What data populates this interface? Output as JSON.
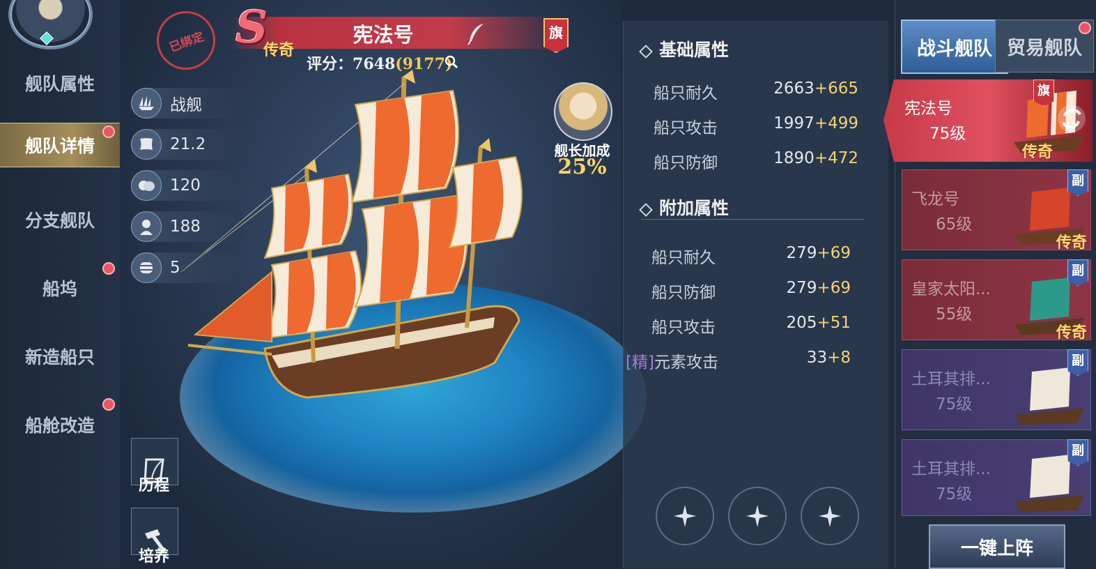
{
  "nav": {
    "items": [
      {
        "label": "舰队属性",
        "active": false,
        "dot": false
      },
      {
        "label": "舰队详情",
        "active": true,
        "dot": true
      },
      {
        "label": "分支舰队",
        "active": false,
        "dot": false
      },
      {
        "label": "船坞",
        "active": false,
        "dot": true
      },
      {
        "label": "新造船只",
        "active": false,
        "dot": false
      },
      {
        "label": "船舱改造",
        "active": false,
        "dot": true
      }
    ]
  },
  "ship": {
    "bound_label": "已绑定",
    "grade": "S",
    "grade_tag": "传奇",
    "name": "宪法号",
    "flag": "旗",
    "score_label": "评分：",
    "score": "7648",
    "score_max": "(9177)"
  },
  "stats": [
    {
      "icon": "ship-type-icon",
      "value": "战舰"
    },
    {
      "icon": "sail-speed-icon",
      "value": "21.2"
    },
    {
      "icon": "supply-icon",
      "value": "120"
    },
    {
      "icon": "sailor-icon",
      "value": "188"
    },
    {
      "icon": "cargo-barrel-icon",
      "value": "5"
    }
  ],
  "captain": {
    "label": "舰长加成",
    "bonus": "25%"
  },
  "side_buttons": {
    "history": "历程",
    "train": "培养"
  },
  "base_attrs": {
    "title": "基础属性",
    "rows": [
      {
        "name": "船只耐久",
        "value": "2663",
        "bonus": "+665"
      },
      {
        "name": "船只攻击",
        "value": "1997",
        "bonus": "+499"
      },
      {
        "name": "船只防御",
        "value": "1890",
        "bonus": "+472"
      }
    ]
  },
  "extra_attrs": {
    "title": "附加属性",
    "rows": [
      {
        "prefix": "",
        "name": "船只耐久",
        "value": "279",
        "bonus": "+69"
      },
      {
        "prefix": "",
        "name": "船只防御",
        "value": "279",
        "bonus": "+69"
      },
      {
        "prefix": "",
        "name": "船只攻击",
        "value": "205",
        "bonus": "+51"
      },
      {
        "prefix": "[精]",
        "name": "元素攻击",
        "value": "33",
        "bonus": "+8"
      }
    ]
  },
  "tabs": {
    "battle": "战斗舰队",
    "trade": "贸易舰队"
  },
  "fleet": [
    {
      "name": "宪法号",
      "level": "75级",
      "tag": "传奇",
      "badge": "旗"
    },
    {
      "name": "飞龙号",
      "level": "65级",
      "tag": "传奇",
      "badge": "副"
    },
    {
      "name": "皇家太阳...",
      "level": "55级",
      "tag": "传奇",
      "badge": "副"
    },
    {
      "name": "土耳其排...",
      "level": "75级",
      "tag": "",
      "badge": "副"
    },
    {
      "name": "土耳其排...",
      "level": "75级",
      "tag": "",
      "badge": "副"
    }
  ],
  "deploy_button": "一键上阵",
  "colors": {
    "accent_gold": "#f4d474",
    "legend_red": "#c63a48",
    "active_tab_blue": "#2f5d95",
    "notification_red": "#e85764"
  }
}
